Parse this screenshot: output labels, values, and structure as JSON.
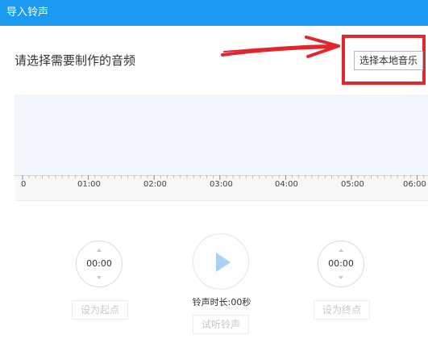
{
  "window": {
    "title": "导入铃声"
  },
  "main": {
    "prompt": "请选择需要制作的音频",
    "select_button_label": "选择本地音乐"
  },
  "timeline": {
    "labels": [
      "0",
      "01:00",
      "02:00",
      "03:00",
      "04:00",
      "05:00",
      "06:00"
    ]
  },
  "controls": {
    "start_time": "00:00",
    "end_time": "00:00",
    "set_start_label": "设为起点",
    "set_end_label": "设为终点",
    "duration_label": "铃声时长:00秒",
    "preview_label": "试听铃声"
  },
  "colors": {
    "titlebar": "#1a9af0",
    "annotation": "#e2262d",
    "waveform_bg": "#f2f7fe",
    "play_icon": "#a9d1f3"
  }
}
